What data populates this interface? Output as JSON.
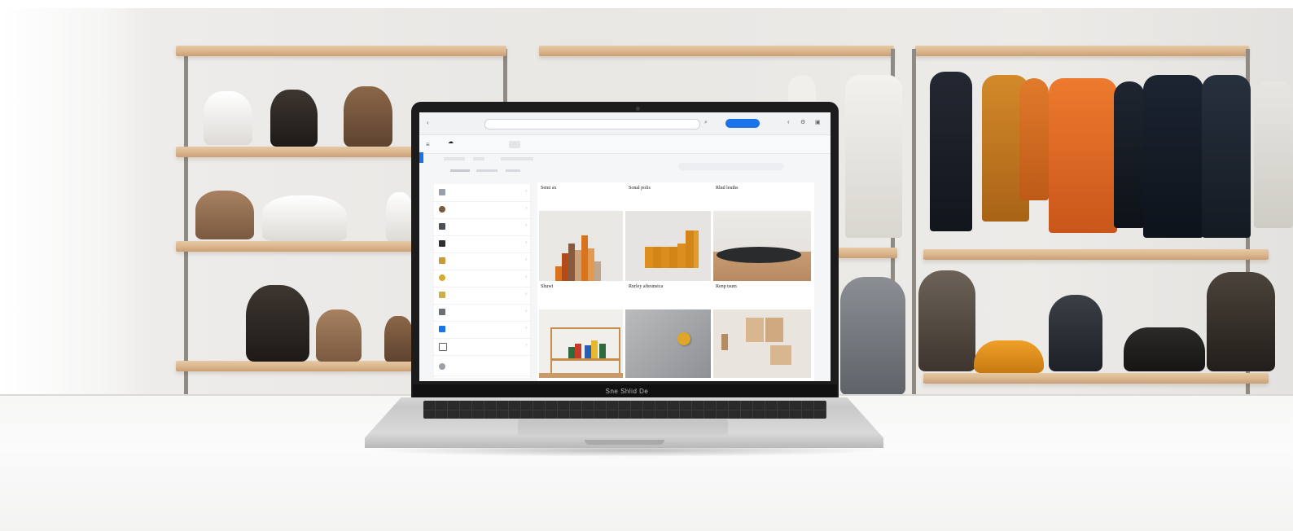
{
  "scene": {
    "description_visible_text": "",
    "colors": {
      "wall": "#ebe9e6",
      "shelf_wood": "#d9b38a",
      "table": "#f7f7f6",
      "laptop_body": "#cfcfcf",
      "screen_accent": "#1a73e8"
    }
  },
  "laptop": {
    "brand_label": "Sne Shlid De"
  },
  "screen_ui": {
    "primary_pill": "",
    "grid_cards": [
      {
        "title": "Semi ax"
      },
      {
        "title": "Sonal polis"
      },
      {
        "title": "Rlud leuths"
      },
      {
        "title": "Shuwi"
      },
      {
        "title": "Rnrley afteunsica"
      },
      {
        "title": "Renp tsum"
      }
    ]
  },
  "icons": [
    "menu-icon",
    "search-icon",
    "back-icon",
    "gear-icon",
    "grid-icon",
    "chevron-right-icon"
  ]
}
